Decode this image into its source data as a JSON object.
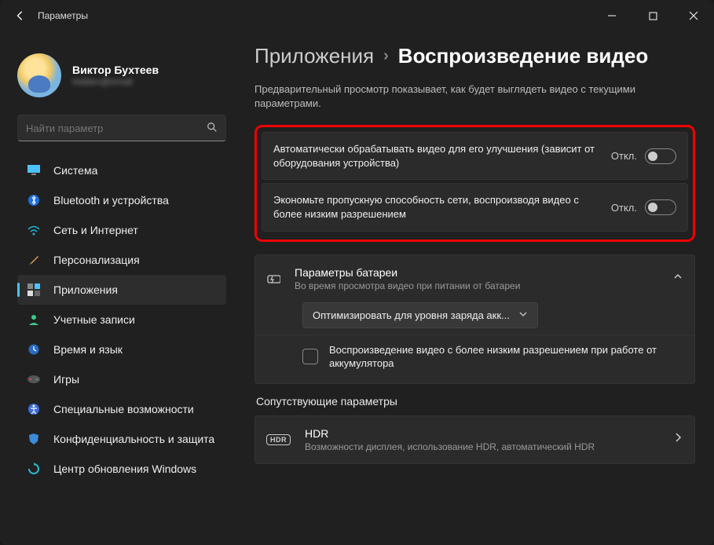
{
  "window": {
    "title": "Параметры"
  },
  "user": {
    "name": "Виктор Бухтеев",
    "email": "hidden@email"
  },
  "search": {
    "placeholder": "Найти параметр"
  },
  "nav": {
    "items": [
      {
        "label": "Система",
        "icon": "🖥️"
      },
      {
        "label": "Bluetooth и устройства",
        "icon": "bt"
      },
      {
        "label": "Сеть и Интернет",
        "icon": "wifi"
      },
      {
        "label": "Персонализация",
        "icon": "🖌️"
      },
      {
        "label": "Приложения",
        "icon": "apps"
      },
      {
        "label": "Учетные записи",
        "icon": "👤"
      },
      {
        "label": "Время и язык",
        "icon": "🕒"
      },
      {
        "label": "Игры",
        "icon": "🎮"
      },
      {
        "label": "Специальные возможности",
        "icon": "a11y"
      },
      {
        "label": "Конфиденциальность и защита",
        "icon": "🔒"
      },
      {
        "label": "Центр обновления Windows",
        "icon": "🔄"
      }
    ]
  },
  "breadcrumb": {
    "parent": "Приложения",
    "current": "Воспроизведение видео"
  },
  "description": "Предварительный просмотр показывает, как будет выглядеть видео с текущими параметрами.",
  "toggles": {
    "autoprocess": {
      "label": "Автоматически обрабатывать видео для его улучшения (зависит от оборудования устройства)",
      "state": "Откл."
    },
    "bandwidth": {
      "label": "Экономьте пропускную способность сети, воспроизводя видео с более низким разрешением",
      "state": "Откл."
    }
  },
  "battery": {
    "title": "Параметры батареи",
    "subtitle": "Во время просмотра видео при питании от батареи",
    "dropdown": "Оптимизировать для уровня заряда акк...",
    "checkbox_label": "Воспроизведение видео с более низким разрешением при работе от аккумулятора"
  },
  "related": {
    "section": "Сопутствующие параметры",
    "hdr": {
      "title": "HDR",
      "subtitle": "Возможности дисплея, использование HDR, автоматический HDR",
      "badge": "HDR"
    }
  }
}
